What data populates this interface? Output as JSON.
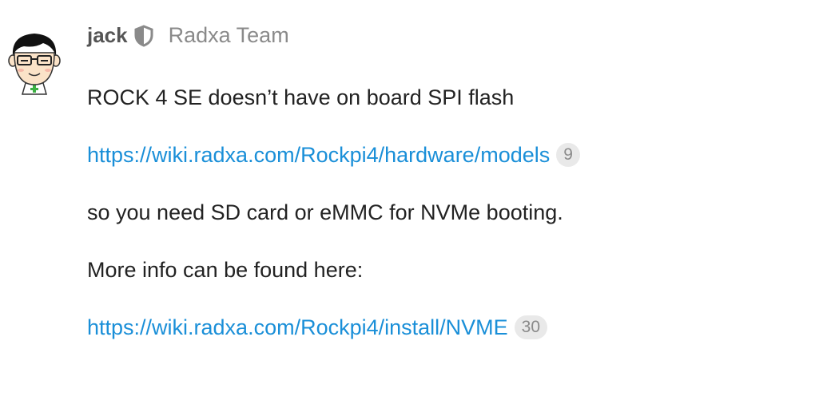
{
  "post": {
    "author": {
      "username": "jack",
      "avatar_icon": "cartoon-avatar-glasses",
      "badge_icon": "moderator-shield-icon",
      "group": "Radxa Team"
    },
    "body": {
      "p1": "ROCK 4 SE doesn’t have on board SPI flash",
      "link1": {
        "text": "https://wiki.radxa.com/Rockpi4/hardware/models",
        "clicks": "9"
      },
      "p3": "so you need SD card or eMMC for NVMe booting.",
      "p4": "More info can be found here:",
      "link2": {
        "text": "https://wiki.radxa.com/Rockpi4/install/NVME",
        "clicks": "30"
      }
    }
  },
  "colors": {
    "link": "#1a8fd8",
    "text": "#222222",
    "muted": "#8a8a8a",
    "badge_bg": "#e9e9e9"
  }
}
